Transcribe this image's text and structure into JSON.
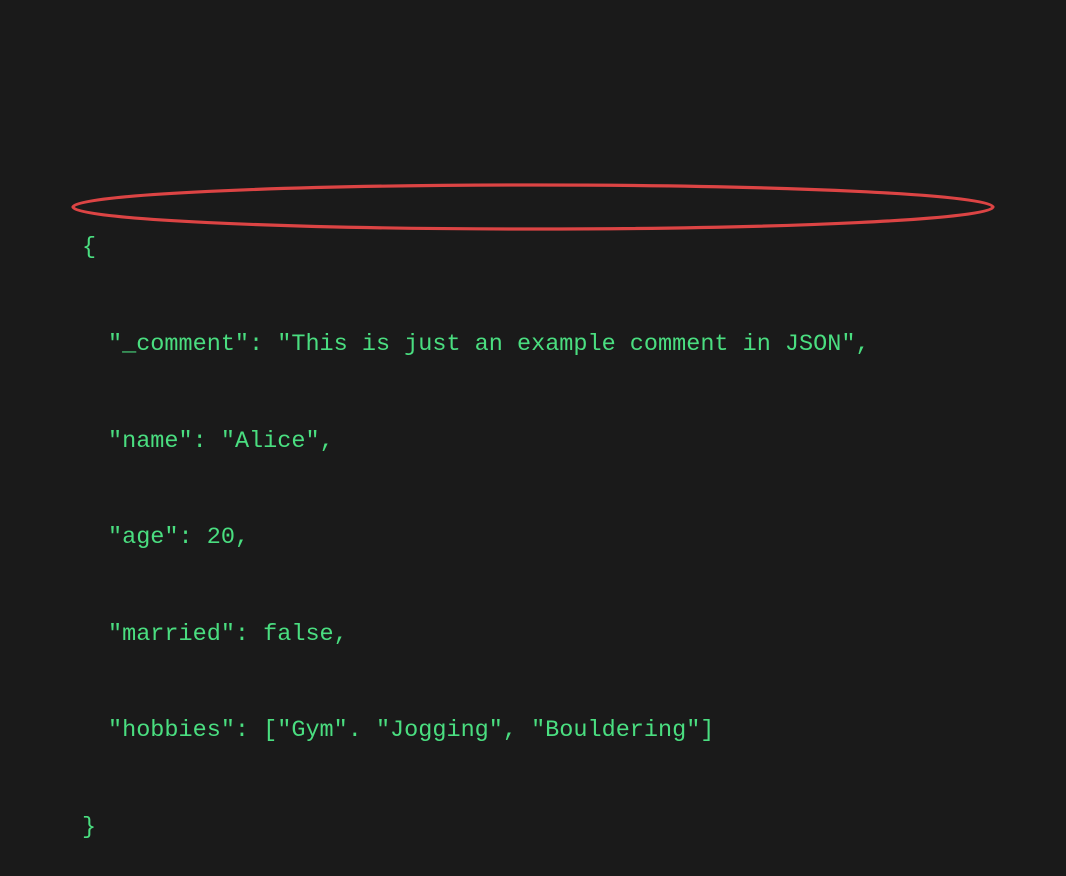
{
  "code": {
    "brace_open": "{",
    "lines": [
      {
        "key": "\"_comment\"",
        "sep": ": ",
        "value": "\"This is just an example comment in JSON\"",
        "tail": ","
      },
      {
        "key": "\"name\"",
        "sep": ": ",
        "value": "\"Alice\"",
        "tail": ","
      },
      {
        "key": "\"age\"",
        "sep": ": ",
        "value": "20",
        "tail": ","
      },
      {
        "key": "\"married\"",
        "sep": ": ",
        "value": "false",
        "tail": ","
      },
      {
        "key": "\"hobbies\"",
        "sep": ": ",
        "value": "[\"Gym\". \"Jogging\", \"Bouldering\"]",
        "tail": ""
      }
    ],
    "brace_close": "}"
  },
  "annotation": {
    "shape": "ellipse",
    "color": "#dc4444",
    "highlights_line_index": 0
  }
}
